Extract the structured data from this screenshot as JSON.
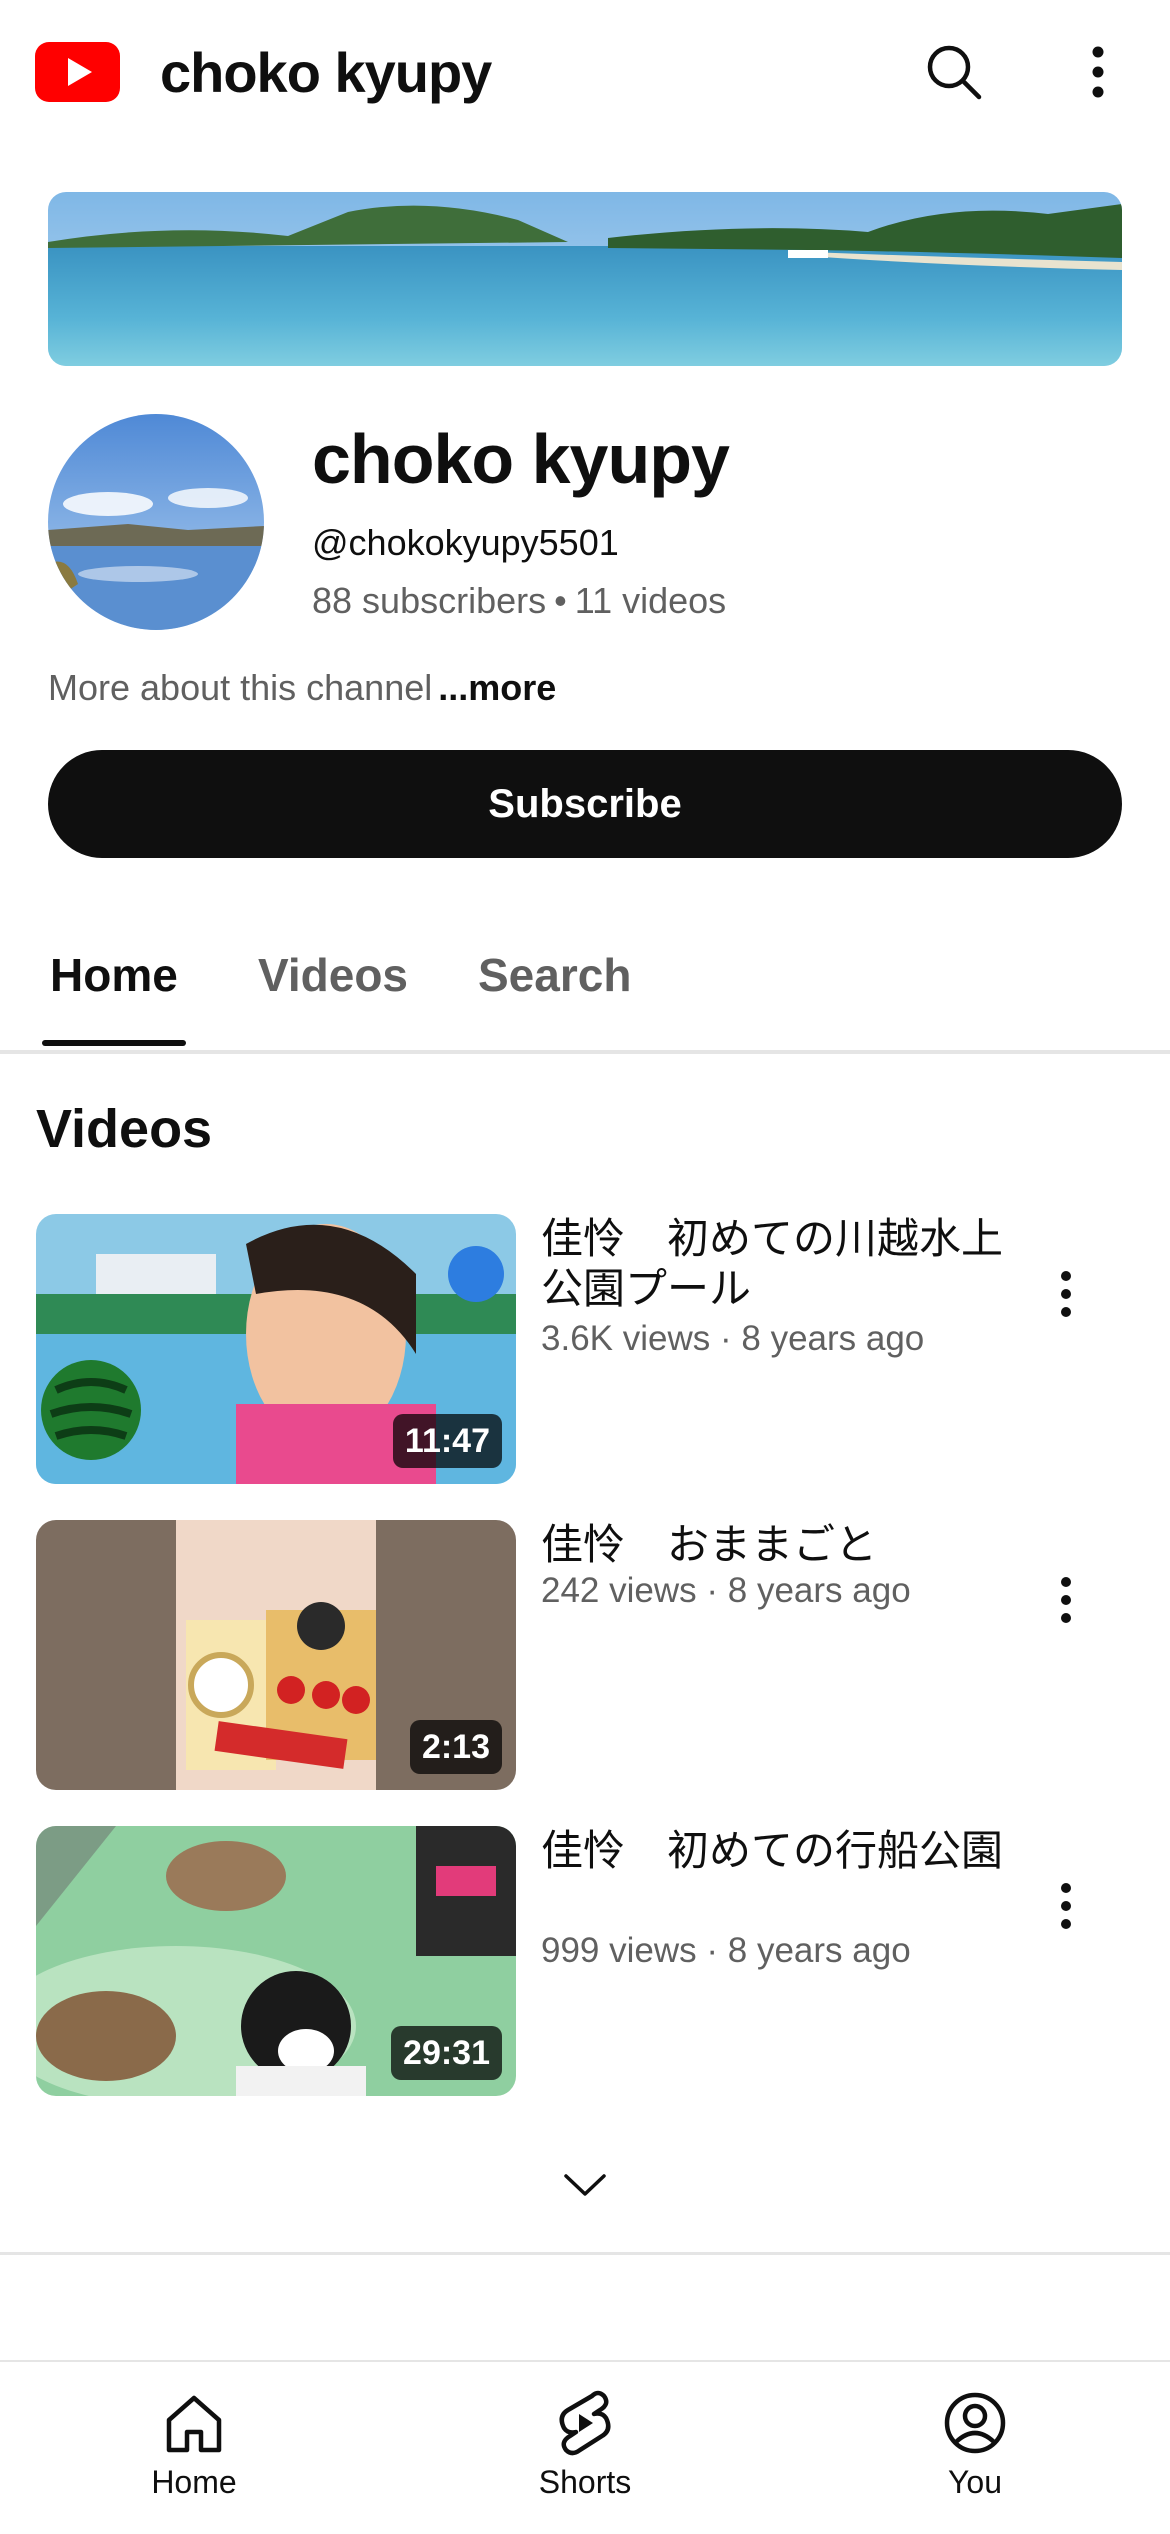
{
  "header": {
    "title": "choko kyupy",
    "logo_icon": "youtube-logo-icon",
    "search_icon": "search-icon",
    "more_icon": "more-vert-icon",
    "brand_color": "#ff0000"
  },
  "channel": {
    "name": "choko kyupy",
    "handle": "@chokokyupy5501",
    "subscribers": "88 subscribers",
    "videos_count": "11 videos",
    "stats_separator": "•",
    "about_text": "More about this channel",
    "about_more": "...more",
    "subscribe_label": "Subscribe"
  },
  "tabs": [
    {
      "label": "Home",
      "active": true
    },
    {
      "label": "Videos",
      "active": false
    },
    {
      "label": "Search",
      "active": false
    }
  ],
  "section": {
    "title": "Videos"
  },
  "videos": [
    {
      "title": "佳怜　初めての川越水上公園プール",
      "views": "3.6K views",
      "age": "8 years ago",
      "duration": "11:47"
    },
    {
      "title": "佳怜　おままごと",
      "views": "242 views",
      "age": "8 years ago",
      "duration": "2:13"
    },
    {
      "title": "佳怜　初めての行船公園",
      "views": "999 views",
      "age": "8 years ago",
      "duration": "29:31"
    }
  ],
  "meta_separator": "·",
  "nav": {
    "home": {
      "label": "Home",
      "icon": "home-icon"
    },
    "shorts": {
      "label": "Shorts",
      "icon": "shorts-icon"
    },
    "you": {
      "label": "You",
      "icon": "account-circle-icon"
    }
  }
}
